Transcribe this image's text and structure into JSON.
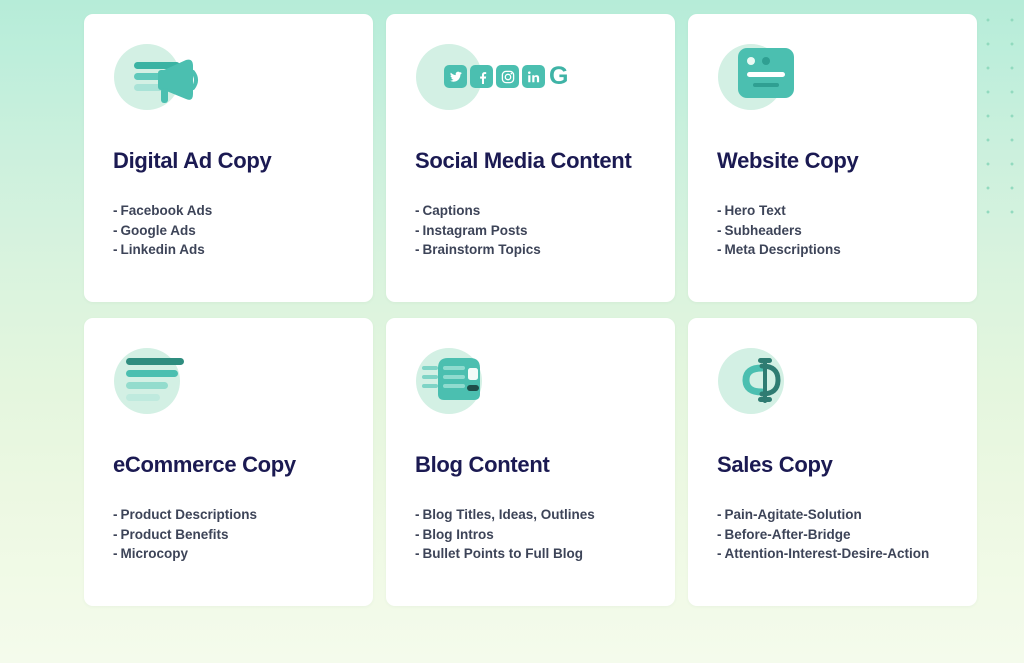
{
  "page": {
    "background_top_color": "#b6ecd8",
    "background_bottom_color": "#f4fbec",
    "accent_color": "#4bbfb0",
    "title_color": "#1b1a52",
    "body_text_color": "#3d4458",
    "card_background": "#ffffff",
    "blob_color": "#d3f0e4",
    "dot_color": "#8fd9bd"
  },
  "cards": [
    {
      "id": "digital-ad-copy",
      "title": "Digital Ad Copy",
      "icon": "megaphone-icon",
      "bullets": [
        "Facebook Ads",
        "Google Ads",
        "Linkedin Ads"
      ],
      "bullet_marker": "-"
    },
    {
      "id": "social-media-content",
      "title": "Social Media Content",
      "icon": "social-networks-icon",
      "social_icons": [
        {
          "name": "twitter-icon",
          "glyph": "twitter"
        },
        {
          "name": "facebook-icon",
          "glyph": "f"
        },
        {
          "name": "instagram-icon",
          "glyph": "instagram"
        },
        {
          "name": "linkedin-icon",
          "glyph": "in"
        },
        {
          "name": "google-icon",
          "glyph": "G"
        }
      ],
      "bullets": [
        "Captions",
        "Instagram Posts",
        "Brainstorm Topics"
      ],
      "bullet_marker": "-"
    },
    {
      "id": "website-copy",
      "title": "Website Copy",
      "icon": "browser-window-icon",
      "bullets": [
        "Hero Text",
        "Subheaders",
        "Meta Descriptions"
      ],
      "bullet_marker": "-"
    },
    {
      "id": "ecommerce-copy",
      "title": "eCommerce Copy",
      "icon": "text-lines-icon",
      "bullets": [
        "Product Descriptions",
        "Product Benefits",
        "Microcopy"
      ],
      "bullet_marker": "-"
    },
    {
      "id": "blog-content",
      "title": "Blog Content",
      "icon": "newspaper-icon",
      "bullets": [
        "Blog Titles, Ideas, Outlines",
        "Blog Intros",
        "Bullet Points to Full Blog"
      ],
      "bullet_marker": "-"
    },
    {
      "id": "sales-copy",
      "title": "Sales Copy",
      "icon": "dollar-sign-icon",
      "bullets": [
        "Pain-Agitate-Solution",
        "Before-After-Bridge",
        "Attention-Interest-Desire-Action"
      ],
      "bullet_marker": "-"
    }
  ]
}
